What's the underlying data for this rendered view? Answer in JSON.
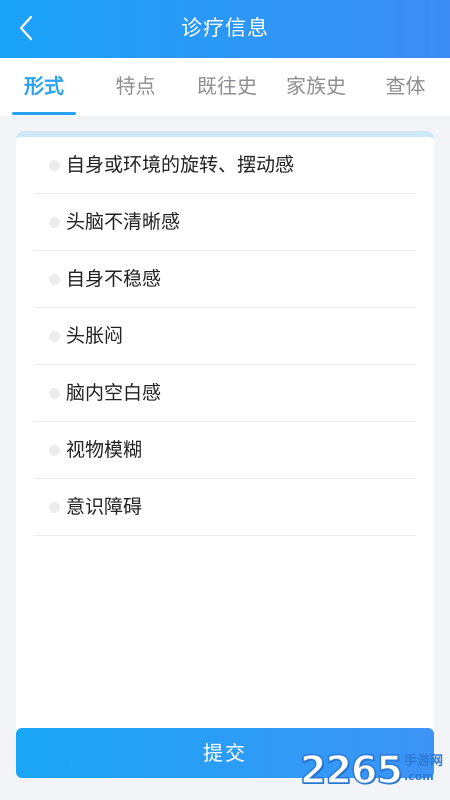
{
  "header": {
    "title": "诊疗信息"
  },
  "tabs": [
    {
      "label": "形式",
      "active": true
    },
    {
      "label": "特点",
      "active": false
    },
    {
      "label": "既往史",
      "active": false
    },
    {
      "label": "家族史",
      "active": false
    },
    {
      "label": "查体",
      "active": false
    }
  ],
  "options": [
    {
      "label": "自身或环境的旋转、摆动感",
      "checked": false
    },
    {
      "label": "头脑不清晰感",
      "checked": false
    },
    {
      "label": "自身不稳感",
      "checked": false
    },
    {
      "label": "头胀闷",
      "checked": false
    },
    {
      "label": "脑内空白感",
      "checked": false
    },
    {
      "label": "视物模糊",
      "checked": false
    },
    {
      "label": "意识障碍",
      "checked": false
    }
  ],
  "submit": {
    "label": "提交"
  },
  "watermark": {
    "number": "2265",
    "cn": "手游网",
    "en": ".com"
  },
  "colors": {
    "header_start": "#1aa3f8",
    "header_end": "#3d8cf5",
    "active_tab": "#2aa2f2",
    "inactive_tab": "#8e8e93"
  }
}
